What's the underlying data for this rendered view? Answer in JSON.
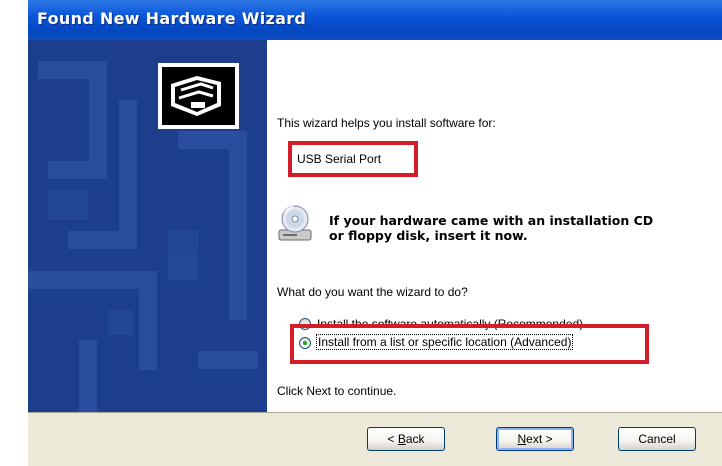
{
  "window": {
    "title": "Found New Hardware Wizard"
  },
  "wizard": {
    "intro": "This wizard helps you install software for:",
    "device_name": "USB Serial Port",
    "cd_prompt_line1": "If your hardware came with an installation CD",
    "cd_prompt_line2": "or floppy disk, insert it now.",
    "question": "What do you want the wizard to do?",
    "options": [
      {
        "label": "Install the software automatically (Recommended)",
        "selected": false
      },
      {
        "label": "Install from a list or specific location (Advanced)",
        "selected": true
      }
    ],
    "continue_hint": "Click Next to continue."
  },
  "buttons": {
    "back_prefix": "< ",
    "back_mnemonic": "B",
    "back_rest": "ack",
    "next_mnemonic": "N",
    "next_rest": "ext >",
    "cancel": "Cancel"
  },
  "colors": {
    "titlebar": "#0a56d8",
    "side_panel": "#1d3d8d",
    "highlight_box": "#d51d2a",
    "dialog_bg": "#ece9d8"
  },
  "icons": {
    "wizard": "hardware-wizard-icon",
    "cd": "cd-drive-icon"
  }
}
